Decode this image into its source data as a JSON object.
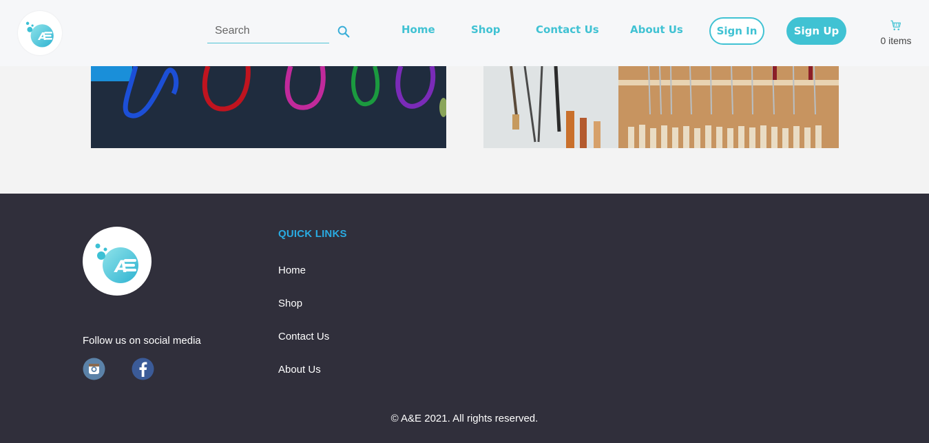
{
  "colors": {
    "accent": "#40c2d3",
    "quick_links_title": "#29abe2",
    "footer_bg": "#302f3b",
    "header_bg": "#f6f7f9",
    "page_bg": "#f3f3f3"
  },
  "header": {
    "logo_icon": "ae-logo-icon",
    "search": {
      "placeholder": "Search",
      "value": "",
      "icon": "search-icon"
    },
    "nav": {
      "home": "Home",
      "shop": "Shop",
      "contact": "Contact Us",
      "about": "About Us"
    },
    "sign_in_label": "Sign In",
    "sign_up_label": "Sign Up",
    "cart": {
      "icon": "cart-icon",
      "count_label": "0 items"
    }
  },
  "content": {
    "images": [
      {
        "subject": "colorful ribbons on dark background"
      },
      {
        "subject": "woodworking tools on a wall rack"
      }
    ]
  },
  "footer": {
    "logo_icon": "ae-logo-icon",
    "follow_text": "Follow us on social media",
    "social": [
      {
        "icon": "instagram-icon"
      },
      {
        "icon": "facebook-icon"
      }
    ],
    "quick_links_title": "QUICK LINKS",
    "quick_links": [
      "Home",
      "Shop",
      "Contact Us",
      "About Us"
    ],
    "copyright": "© A&E 2021. All rights reserved."
  }
}
